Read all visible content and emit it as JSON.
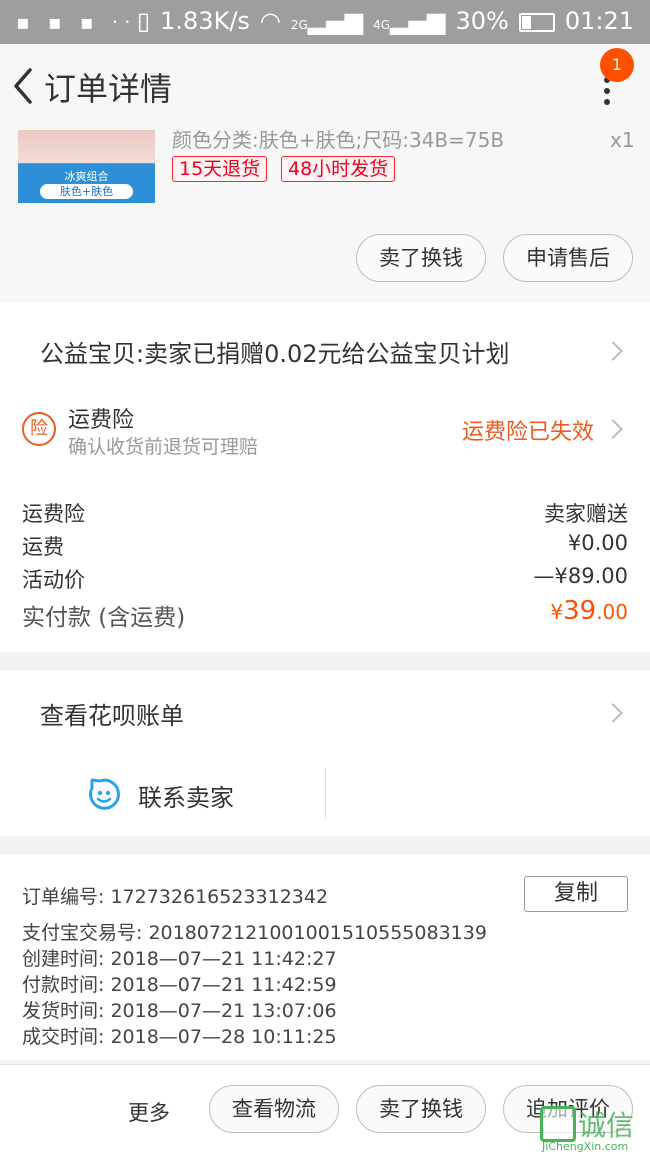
{
  "status_bar": {
    "left_icons": "▪ ▪ ▪ ···",
    "network_speed": "1.83K/s",
    "signal_2g": "2G",
    "signal_4g": "4G",
    "battery": "30%",
    "time": "01:21"
  },
  "nav": {
    "title": "订单详情",
    "badge_count": "1"
  },
  "product": {
    "image_caption_1": "冰爽组合",
    "image_caption_2": "肤色+肤色",
    "sku_text": "颜色分类:肤色+肤色;尺码:34B=75B",
    "quantity": "x1",
    "tags": [
      "15天退货",
      "48小时发货"
    ],
    "actions": [
      "卖了换钱",
      "申请售后"
    ]
  },
  "charity": {
    "text": "公益宝贝:卖家已捐赠0.02元给公益宝贝计划"
  },
  "insurance": {
    "icon_char": "险",
    "title": "运费险",
    "subtitle": "确认收货前退货可理赔",
    "status": "运费险已失效"
  },
  "fees": {
    "rows": [
      {
        "label": "运费险",
        "value": "卖家赠送"
      },
      {
        "label": "运费",
        "value": "¥0.00"
      },
      {
        "label": "活动价",
        "value": "—¥89.00"
      }
    ],
    "paid_label": "实付款 (含运费)",
    "paid_currency": "¥",
    "paid_int": "39",
    "paid_dec": ".00"
  },
  "huabei": {
    "label": "查看花呗账单"
  },
  "contact": {
    "label": "联系卖家"
  },
  "order_info": {
    "order_no_label": "订单编号: ",
    "order_no": "172732616523312342",
    "copy_label": "复制",
    "alipay_label": "支付宝交易号: ",
    "alipay_no": "2018072121001001510555083139",
    "created_label": "创建时间: ",
    "created": "2018—07—21 11:42:27",
    "paid_label": "付款时间: ",
    "paid": "2018—07—21 11:42:59",
    "shipped_label": "发货时间: ",
    "shipped": "2018—07—21 13:07:06",
    "completed_label": "成交时间: ",
    "completed": "2018—07—28 10:11:25"
  },
  "bottom_bar": {
    "more": "更多",
    "buttons": [
      "查看物流",
      "卖了换钱",
      "追加评价"
    ]
  },
  "watermark": {
    "text": "诚信",
    "url": "JiChengXin.com"
  },
  "colors": {
    "accent": "#ff5000",
    "insurance": "#f05a1e",
    "tag_red": "#e02020"
  }
}
